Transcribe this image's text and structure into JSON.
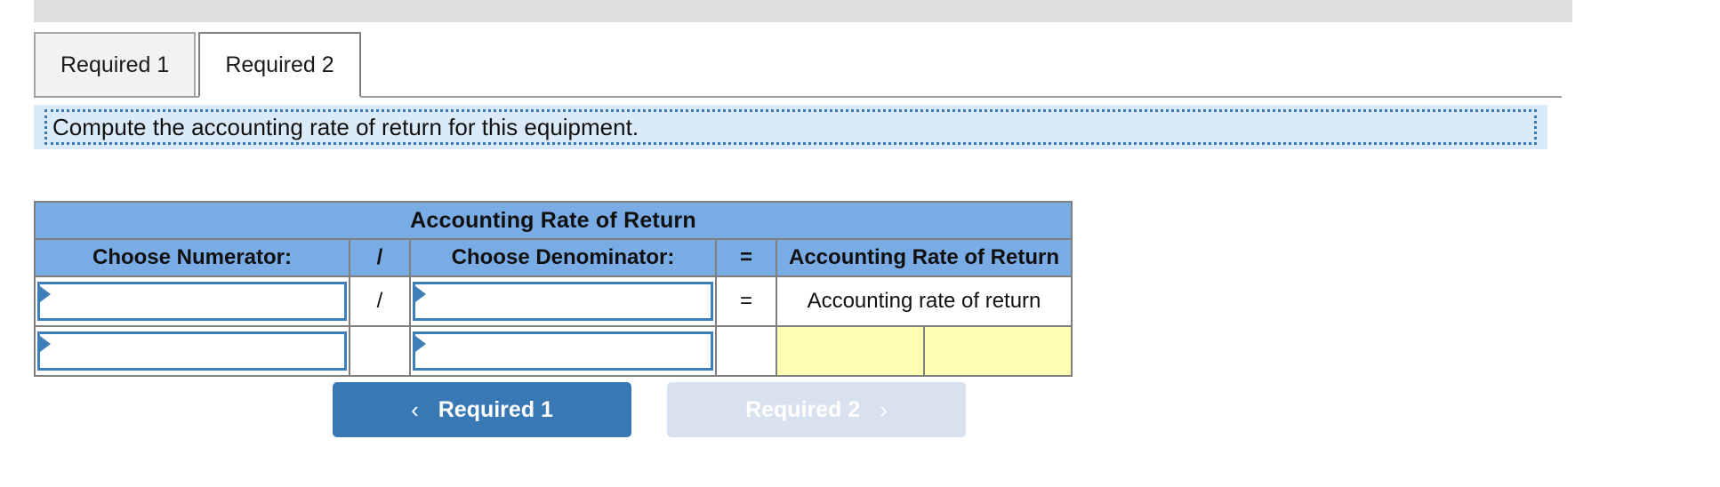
{
  "tabs": [
    {
      "label": "Required 1",
      "active": false
    },
    {
      "label": "Required 2",
      "active": true
    }
  ],
  "instruction": "Compute the accounting rate of return for this equipment.",
  "table": {
    "title": "Accounting Rate of Return",
    "headers": [
      "Choose Numerator:",
      "/",
      "Choose Denominator:",
      "=",
      "Accounting Rate of Return"
    ],
    "rows": [
      {
        "numerator": "",
        "operator": "/",
        "denominator": "",
        "equals": "=",
        "result": "Accounting rate of return"
      },
      {
        "numerator": "",
        "operator": "",
        "denominator": "",
        "equals": "",
        "result": ""
      }
    ]
  },
  "nav": {
    "prev_label": "Required 1",
    "prev_icon": "chevron-left-icon",
    "prev_chevron": "‹",
    "next_label": "Required 2",
    "next_icon": "chevron-right-icon",
    "next_chevron": "›"
  },
  "colors": {
    "header_blue": "#79ace5",
    "banner_blue": "#daeaf8",
    "dotted_border": "#3a78b8",
    "primary_button": "#3778b5",
    "disabled_button": "#d8e1ee",
    "highlight_yellow": "#ffffb3",
    "dropdown_border": "#3e7fba"
  }
}
